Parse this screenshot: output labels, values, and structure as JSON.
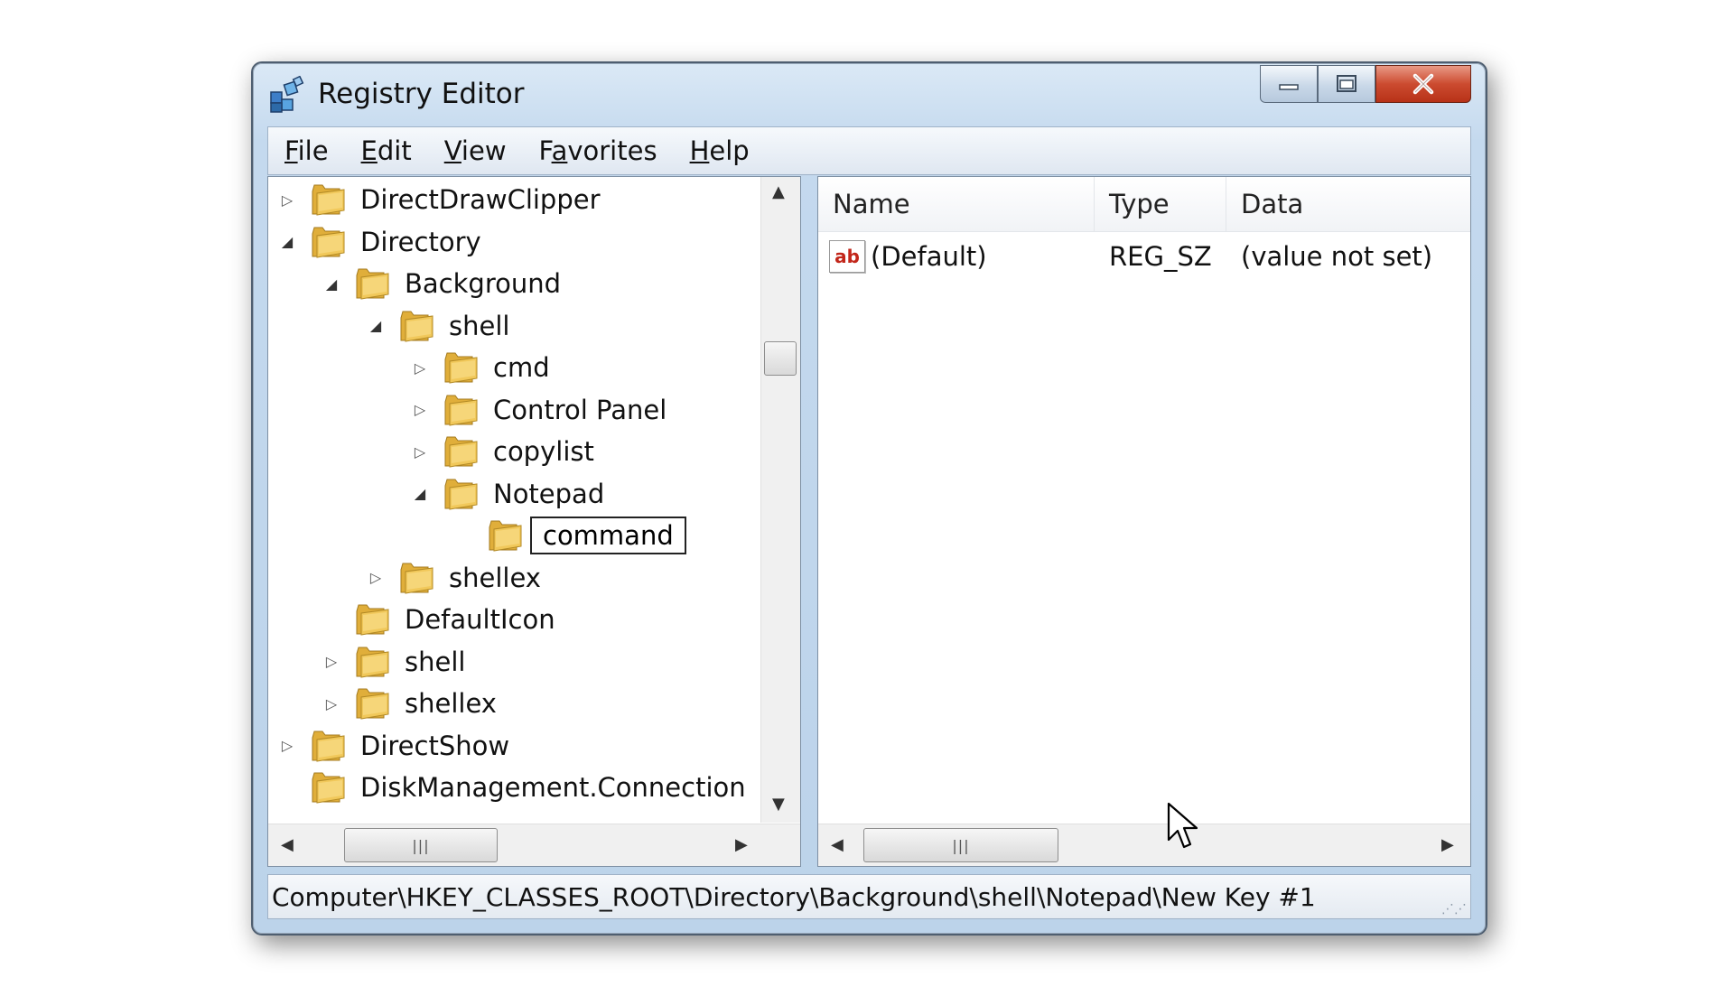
{
  "window": {
    "title": "Registry Editor",
    "buttons": {
      "minimize": "minimize",
      "maximize": "maximize",
      "close": "close"
    }
  },
  "menu": [
    {
      "label": "File",
      "accel": "F",
      "rest": "ile"
    },
    {
      "label": "Edit",
      "accel": "E",
      "rest": "dit"
    },
    {
      "label": "View",
      "accel": "V",
      "rest": "iew"
    },
    {
      "label": "Favorites",
      "pre": "F",
      "accel": "a",
      "rest": "vorites"
    },
    {
      "label": "Help",
      "accel": "H",
      "rest": "elp"
    }
  ],
  "tree": [
    {
      "label": "DirectDrawClipper",
      "level": 0,
      "expander": "collapsed"
    },
    {
      "label": "Directory",
      "level": 0,
      "expander": "expanded"
    },
    {
      "label": "Background",
      "level": 1,
      "expander": "expanded"
    },
    {
      "label": "shell",
      "level": 2,
      "expander": "expanded"
    },
    {
      "label": "cmd",
      "level": 3,
      "expander": "collapsed"
    },
    {
      "label": "Control Panel",
      "level": 3,
      "expander": "collapsed"
    },
    {
      "label": "copylist",
      "level": 3,
      "expander": "collapsed"
    },
    {
      "label": "Notepad",
      "level": 3,
      "expander": "expanded"
    },
    {
      "label": "command",
      "level": 4,
      "expander": "none",
      "editing": true
    },
    {
      "label": "shellex",
      "level": 2,
      "expander": "collapsed"
    },
    {
      "label": "DefaultIcon",
      "level": 1,
      "expander": "none"
    },
    {
      "label": "shell",
      "level": 1,
      "expander": "collapsed"
    },
    {
      "label": "shellex",
      "level": 1,
      "expander": "collapsed"
    },
    {
      "label": "DirectShow",
      "level": 0,
      "expander": "collapsed"
    },
    {
      "label": "DiskManagement.Connection",
      "level": 0,
      "expander": "none"
    }
  ],
  "values_pane": {
    "columns": [
      "Name",
      "Type",
      "Data"
    ],
    "rows": [
      {
        "icon": "string-value-icon",
        "icon_text": "ab",
        "name": "(Default)",
        "type": "REG_SZ",
        "data": "(value not set)"
      }
    ]
  },
  "status": {
    "path": "Computer\\HKEY_CLASSES_ROOT\\Directory\\Background\\shell\\Notepad\\New Key #1"
  },
  "colors": {
    "title_gradient_top": "#dbe9f6",
    "close_button": "#cc4b30",
    "folder_yellow": "#f1c85a"
  }
}
